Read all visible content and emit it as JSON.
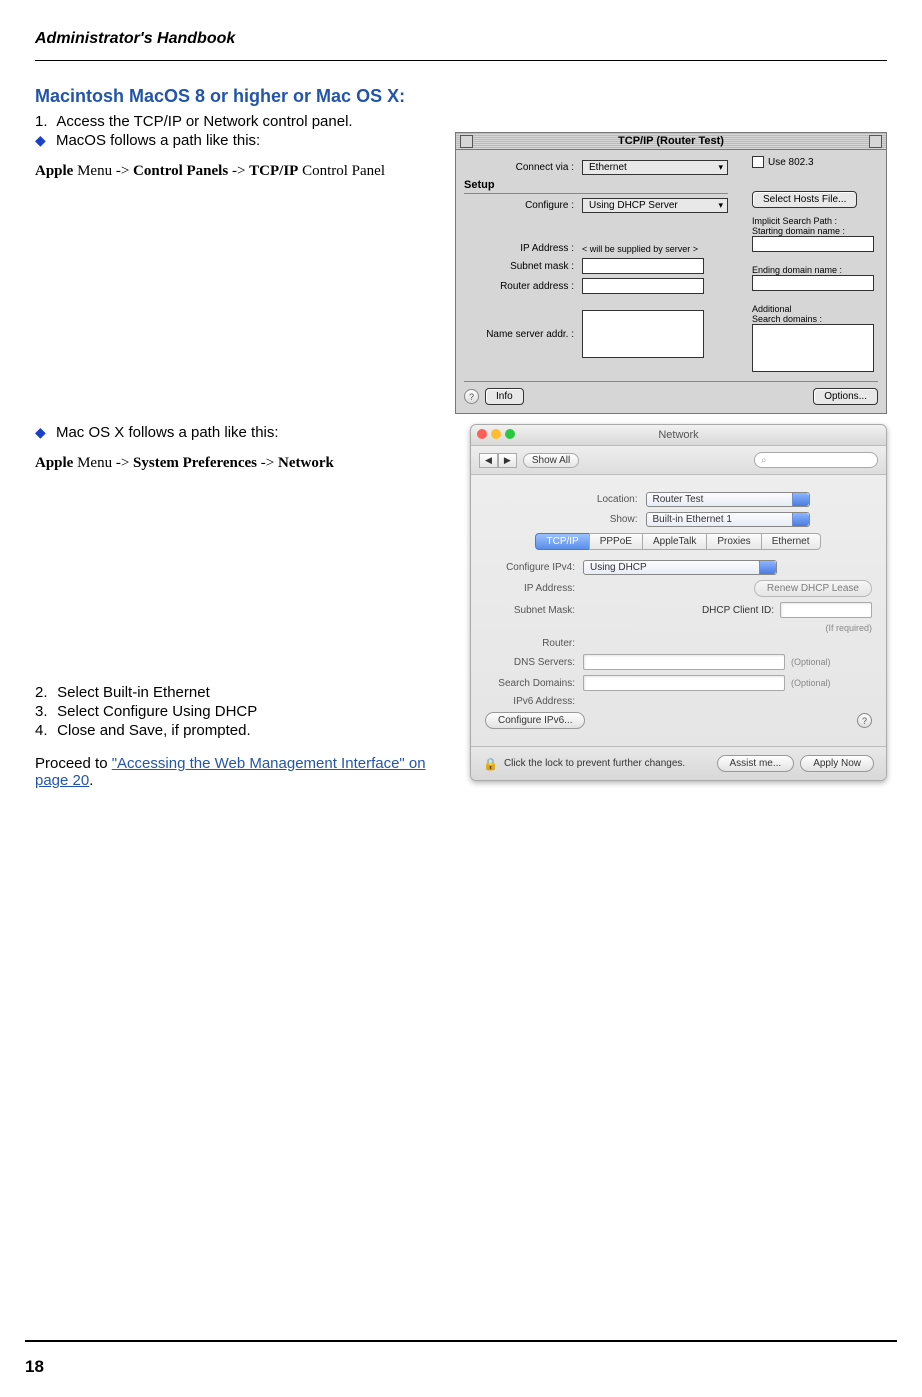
{
  "header": {
    "title": "Administrator's Handbook"
  },
  "heading": "Macintosh MacOS 8 or higher or Mac OS X:",
  "step1": {
    "num": "1.",
    "text": "Access the TCP/IP or Network control panel."
  },
  "macos_bullet": "MacOS follows a path like this:",
  "macos_path": {
    "p1": "Apple",
    "p2": " Menu -> ",
    "p3": "Control Panels",
    "p4": " -> ",
    "p5": "TCP/IP",
    "p6": " Control Panel"
  },
  "osx_bullet": "Mac OS X follows a path like this:",
  "osx_path": {
    "p1": "Apple",
    "p2": " Menu -> ",
    "p3": "System Preferences",
    "p4": " -> ",
    "p5": "Network"
  },
  "step2": {
    "num": "2.",
    "text": "Select Built-in Ethernet"
  },
  "step3": {
    "num": "3.",
    "text": "Select Configure Using DHCP"
  },
  "step4": {
    "num": "4.",
    "text": "Close and Save, if prompted."
  },
  "proceed_pre": "Proceed to ",
  "proceed_link": "\"Accessing the Web Management Interface\" on page 20",
  "proceed_post": ".",
  "page_number": "18",
  "mac9": {
    "title": "TCP/IP (Router Test)",
    "setup": "Setup",
    "connect_via_lbl": "Connect via :",
    "connect_via_val": "Ethernet",
    "use8023": "Use 802.3",
    "configure_lbl": "Configure :",
    "configure_val": "Using DHCP Server",
    "select_hosts": "Select Hosts File...",
    "implicit": "Implicit Search Path :",
    "starting": "Starting domain name :",
    "ip_lbl": "IP Address :",
    "ip_val": "< will be supplied by server >",
    "subnet_lbl": "Subnet mask :",
    "router_lbl": "Router address :",
    "ending": "Ending domain name :",
    "additional": "Additional",
    "searchdomains": "Search domains :",
    "ns_lbl": "Name server addr. :",
    "info": "Info",
    "options": "Options...",
    "q": "?"
  },
  "osx": {
    "title": "Network",
    "showall": "Show All",
    "location_lbl": "Location:",
    "location_val": "Router Test",
    "show_lbl": "Show:",
    "show_val": "Built-in Ethernet 1",
    "tabs": [
      "TCP/IP",
      "PPPoE",
      "AppleTalk",
      "Proxies",
      "Ethernet"
    ],
    "cfg4_lbl": "Configure IPv4:",
    "cfg4_val": "Using DHCP",
    "ip_lbl": "IP Address:",
    "renew": "Renew DHCP Lease",
    "subnet_lbl": "Subnet Mask:",
    "clientid_lbl": "DHCP Client ID:",
    "required": "(If required)",
    "router_lbl": "Router:",
    "dns_lbl": "DNS Servers:",
    "optional": "(Optional)",
    "search_lbl": "Search Domains:",
    "ipv6_lbl": "IPv6 Address:",
    "cfg6": "Configure IPv6...",
    "lock_text": "Click the lock to prevent further changes.",
    "assist": "Assist me...",
    "apply": "Apply Now",
    "nav_back": "◀",
    "nav_fwd": "▶",
    "q": "?"
  }
}
